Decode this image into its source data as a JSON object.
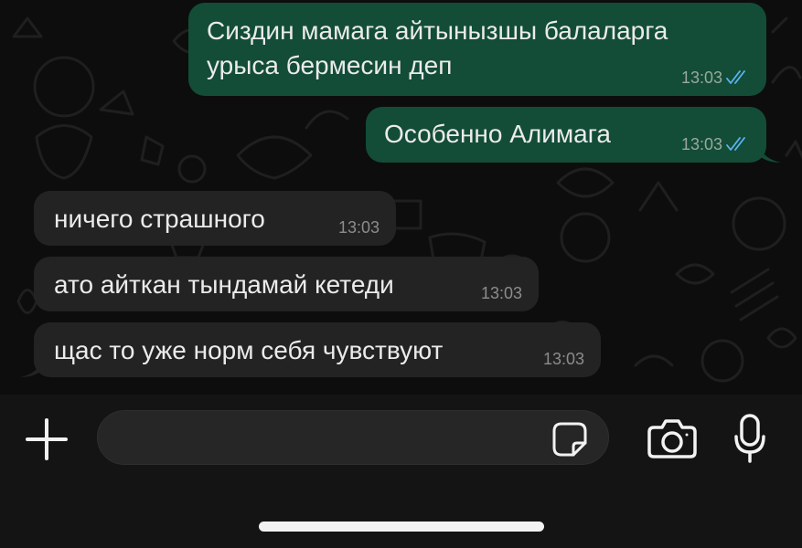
{
  "colors": {
    "outgoing_bubble": "#134d37",
    "incoming_bubble": "#232323",
    "read_ticks": "#5ab4f0",
    "background": "#0b0b0b"
  },
  "messages": [
    {
      "direction": "outgoing",
      "text": "Сиздин мамага айтынызшы балаларга",
      "text_line2": "урыса бермесин деп",
      "time": "13:03",
      "status": "read"
    },
    {
      "direction": "outgoing",
      "text": "Особенно Алимага",
      "time": "13:03",
      "status": "read"
    },
    {
      "direction": "incoming",
      "text": "ничего страшного",
      "time": "13:03"
    },
    {
      "direction": "incoming",
      "text": "ато айткан тындамай кетеди",
      "time": "13:03"
    },
    {
      "direction": "incoming",
      "text": "щас то уже норм себя чувствуют",
      "time": "13:03"
    }
  ],
  "input_bar": {
    "attach_icon": "plus-icon",
    "message_placeholder": "",
    "sticker_icon": "sticker-icon",
    "camera_icon": "camera-icon",
    "mic_icon": "microphone-icon"
  }
}
